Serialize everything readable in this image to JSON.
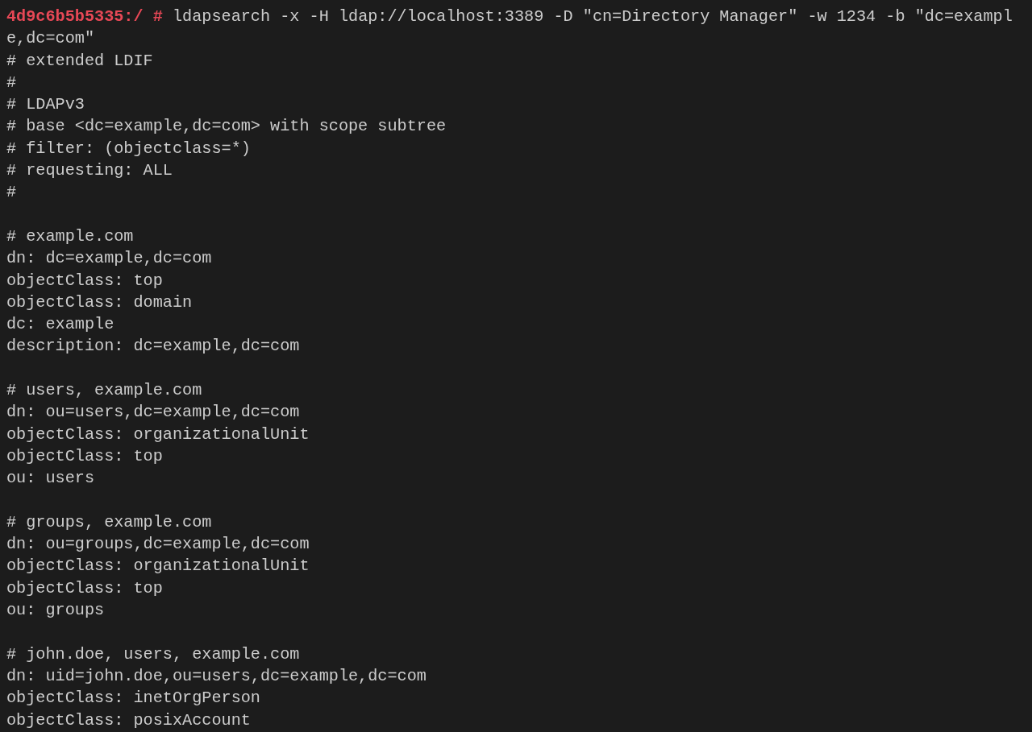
{
  "terminal": {
    "lines": [
      {
        "kind": "prompt",
        "prompt": "4d9c6b5b5335:/ #",
        "command": "ldapsearch -x -H ldap://localhost:3389 -D \"cn=Directory Manager\" -w 1234 -b \"dc=example,dc=com\""
      },
      {
        "kind": "output",
        "text": "# extended LDIF"
      },
      {
        "kind": "output",
        "text": "#"
      },
      {
        "kind": "output",
        "text": "# LDAPv3"
      },
      {
        "kind": "output",
        "text": "# base <dc=example,dc=com> with scope subtree"
      },
      {
        "kind": "output",
        "text": "# filter: (objectclass=*)"
      },
      {
        "kind": "output",
        "text": "# requesting: ALL"
      },
      {
        "kind": "output",
        "text": "#"
      },
      {
        "kind": "blank"
      },
      {
        "kind": "output",
        "text": "# example.com"
      },
      {
        "kind": "output",
        "text": "dn: dc=example,dc=com"
      },
      {
        "kind": "output",
        "text": "objectClass: top"
      },
      {
        "kind": "output",
        "text": "objectClass: domain"
      },
      {
        "kind": "output",
        "text": "dc: example"
      },
      {
        "kind": "output",
        "text": "description: dc=example,dc=com"
      },
      {
        "kind": "blank"
      },
      {
        "kind": "output",
        "text": "# users, example.com"
      },
      {
        "kind": "output",
        "text": "dn: ou=users,dc=example,dc=com"
      },
      {
        "kind": "output",
        "text": "objectClass: organizationalUnit"
      },
      {
        "kind": "output",
        "text": "objectClass: top"
      },
      {
        "kind": "output",
        "text": "ou: users"
      },
      {
        "kind": "blank"
      },
      {
        "kind": "output",
        "text": "# groups, example.com"
      },
      {
        "kind": "output",
        "text": "dn: ou=groups,dc=example,dc=com"
      },
      {
        "kind": "output",
        "text": "objectClass: organizationalUnit"
      },
      {
        "kind": "output",
        "text": "objectClass: top"
      },
      {
        "kind": "output",
        "text": "ou: groups"
      },
      {
        "kind": "blank"
      },
      {
        "kind": "output",
        "text": "# john.doe, users, example.com"
      },
      {
        "kind": "output",
        "text": "dn: uid=john.doe,ou=users,dc=example,dc=com"
      },
      {
        "kind": "output",
        "text": "objectClass: inetOrgPerson"
      },
      {
        "kind": "output",
        "text": "objectClass: posixAccount"
      }
    ]
  }
}
